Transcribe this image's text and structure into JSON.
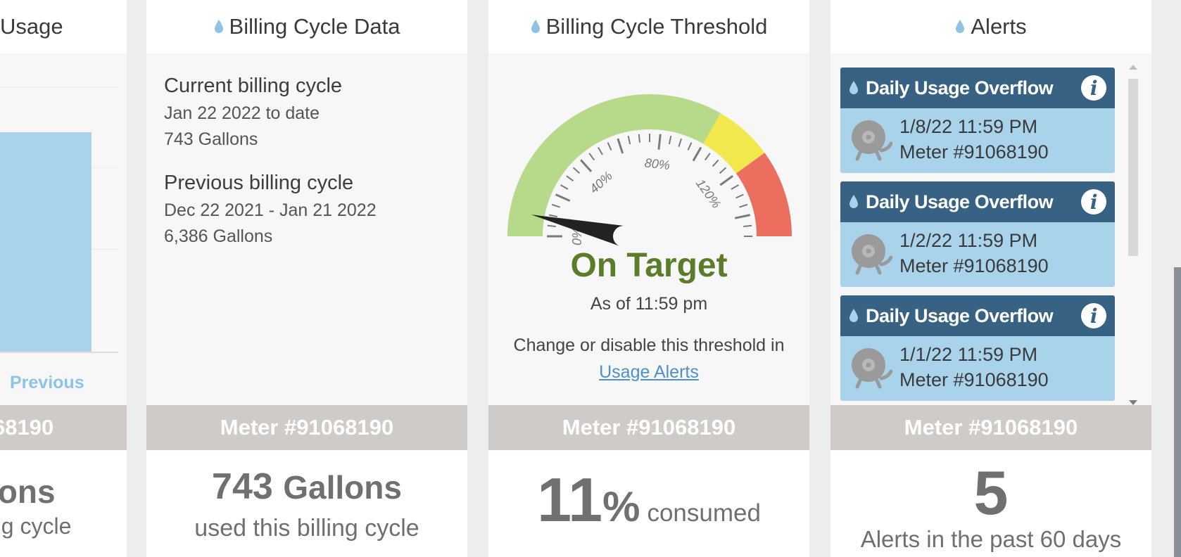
{
  "colors": {
    "accent_blue": "#8fc3e5",
    "bar_blue": "#a9d3ea",
    "alert_header": "#386283",
    "meter_bar": "#cfcbc9",
    "gauge_green": "#b6d98a",
    "gauge_yellow": "#f2e84e",
    "gauge_red": "#ec6e5f",
    "on_target_text": "#5a7d2a"
  },
  "usage_card": {
    "title": "Usage",
    "bar_label": "Previous",
    "meter": "68190",
    "footer_value": "lons",
    "footer_caption": "ng cycle"
  },
  "billing_data_card": {
    "icon": "water-drop-icon",
    "title": "Billing Cycle Data",
    "current": {
      "heading": "Current billing cycle",
      "range": "Jan 22 2022 to date",
      "amount": "743 Gallons"
    },
    "previous": {
      "heading": "Previous billing cycle",
      "range": "Dec 22 2021 - Jan 21 2022",
      "amount": "6,386 Gallons"
    },
    "meter": "Meter #91068190",
    "footer_value": "743",
    "footer_unit": "Gallons",
    "footer_caption": "used this billing cycle"
  },
  "threshold_card": {
    "icon": "water-drop-icon",
    "title": "Billing Cycle Threshold",
    "gauge": {
      "tick_labels": [
        "0%",
        "40%",
        "80%",
        "120%"
      ],
      "max_percent": 150,
      "green_until": 100,
      "yellow_until": 120,
      "value_percent": 11
    },
    "status": "On Target",
    "as_of": "As of 11:59 pm",
    "change_text": "Change or disable this threshold in",
    "link_text": "Usage Alerts",
    "meter": "Meter #91068190",
    "footer_number": "11",
    "footer_percent": "%",
    "footer_word": "consumed"
  },
  "alerts_card": {
    "icon": "water-drop-icon",
    "title": "Alerts",
    "items": [
      {
        "title": "Daily Usage Overflow",
        "datetime": "1/8/22 11:59 PM",
        "meter": "Meter #91068190"
      },
      {
        "title": "Daily Usage Overflow",
        "datetime": "1/2/22 11:59 PM",
        "meter": "Meter #91068190"
      },
      {
        "title": "Daily Usage Overflow",
        "datetime": "1/1/22 11:59 PM",
        "meter": "Meter #91068190"
      }
    ],
    "meter": "Meter #91068190",
    "footer_count": "5",
    "footer_caption": "Alerts in the past 60 days"
  }
}
